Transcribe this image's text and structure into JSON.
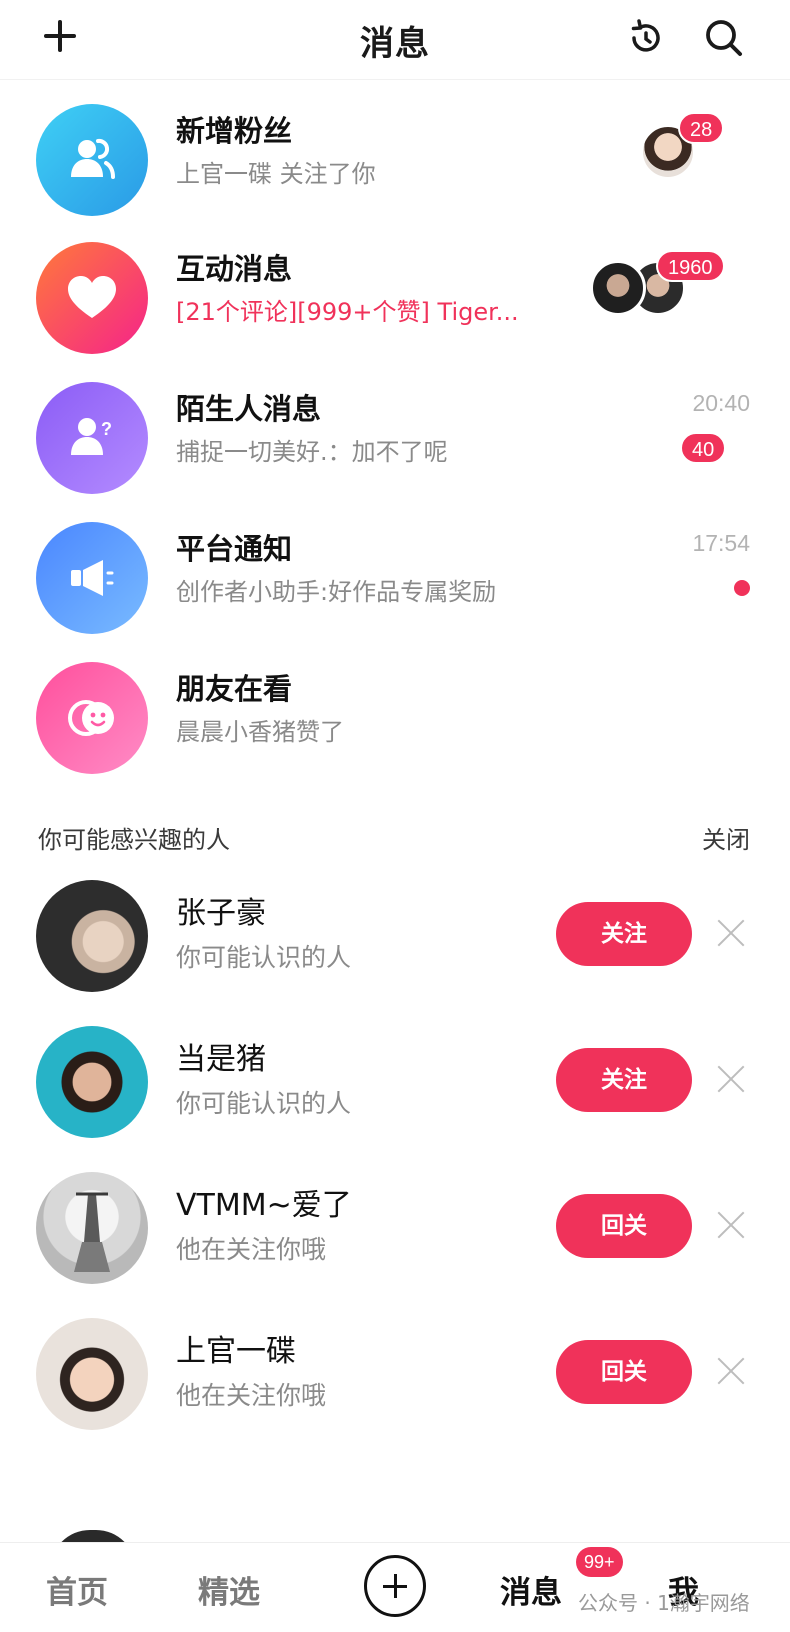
{
  "header": {
    "title": "消息",
    "icons": [
      "plus-icon",
      "history-icon",
      "search-icon"
    ]
  },
  "messages": [
    {
      "title": "新增粉丝",
      "subtitle": "上官一碟 关注了你",
      "badge": "28",
      "icon": "users-icon",
      "color_from": "#38c7f2",
      "color_to": "#2aa8e8"
    },
    {
      "title": "互动消息",
      "subtitle": "[21个评论][999+个赞] Tiger...",
      "badge": "1960",
      "icon": "heart-icon",
      "color_from": "#ff6a3d",
      "color_to": "#f72585"
    },
    {
      "title": "陌生人消息",
      "subtitle": "捕捉一切美好.：加不了呢",
      "time": "20:40",
      "badge": "40",
      "icon": "stranger-icon",
      "color_from": "#8f5cf6",
      "color_to": "#b388ff"
    },
    {
      "title": "平台通知",
      "subtitle": "创作者小助手:好作品专属奖励",
      "time": "17:54",
      "icon": "megaphone-icon",
      "color_from": "#4c8dff",
      "color_to": "#6fb6ff"
    },
    {
      "title": "朋友在看",
      "subtitle": "晨晨小香猪赞了",
      "icon": "smile-icon",
      "color_from": "#ff5aa5",
      "color_to": "#ff8ac4"
    }
  ],
  "suggest": {
    "heading": "你可能感兴趣的人",
    "close_label": "关闭",
    "people": [
      {
        "name": "张子豪",
        "desc": "你可能认识的人",
        "button": "关注"
      },
      {
        "name": "当是猪",
        "desc": "你可能认识的人",
        "button": "关注"
      },
      {
        "name": "VTMM~爱了",
        "desc": "他在关注你哦",
        "button": "回关"
      },
      {
        "name": "上官一碟",
        "desc": "他在关注你哦",
        "button": "回关"
      }
    ]
  },
  "nav": {
    "home": "首页",
    "featured": "精选",
    "messages": "消息",
    "messages_badge": "99+",
    "me": "我",
    "watermark": "公众号 · 1瀚宇网络"
  },
  "colors": {
    "accent": "#f0325a"
  }
}
